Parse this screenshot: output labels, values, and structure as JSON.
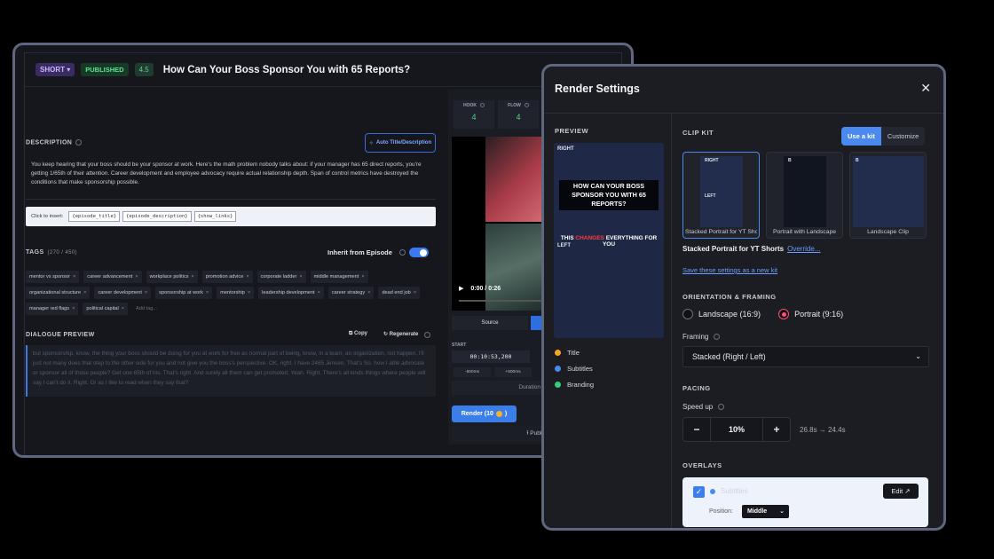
{
  "episode": {
    "badge_short": "SHORT ▾",
    "badge_status": "PUBLISHED",
    "score": "4.5",
    "title": "How Can Your Boss Sponsor You with 65 Reports?"
  },
  "description": {
    "label": "DESCRIPTION",
    "auto_button": "Auto Title/Description",
    "text": "You keep hearing that your boss should be your sponsor at work. Here's the math problem nobody talks about: if your manager has 65 direct reports, you're getting 1/65th of their attention. Career development and employee advocacy require actual relationship depth. Span of control metrics have destroyed the conditions that make sponsorship possible.",
    "insert_label": "Click to insert:",
    "tokens": [
      "{episode_title}",
      "{episode_description}",
      "{show_links}"
    ]
  },
  "tags": {
    "label": "TAGS",
    "count": "(270 / 450)",
    "inherit_label": "Inherit from Episode",
    "items": [
      "mentor vs sponsor",
      "career advancement",
      "workplace politics",
      "promotion advice",
      "corporate ladder",
      "middle management",
      "organizational structure",
      "career development",
      "sponsorship at work",
      "mentorship",
      "leadership development",
      "career strategy",
      "dead end job",
      "manager red flags",
      "political capital"
    ],
    "add_placeholder": "Add tag..."
  },
  "dialogue": {
    "label": "DIALOGUE PREVIEW",
    "copy": "Copy",
    "regenerate": "Regenerate",
    "text": "but sponsorship, know, the thing your boss should be doing for you at work for free as normal part of being, know, in a team, an organization, not happen. I'll just not many does that step to the other side for you and not give you the boss's perspective. OK, right. I have 2465 Jensen. That's So. how I able advocate or sponsor all of those people? Get one 65th of his. That's right. And surely all them can get promoted. Yeah. Right. There's all kinds things where people will say I can't do it. Right. Or as I like to read when they say that?"
  },
  "right_panel": {
    "hook_label": "HOOK",
    "hook_value": "4",
    "flow_label": "FLOW",
    "flow_value": "4",
    "video_time": "0:00 / 0:26",
    "source_tab": "Source",
    "start_label": "START",
    "start_time": "00:10:53,200",
    "nudge_minus": "-500ms",
    "nudge_plus": "+500ms",
    "duration_label": "Duration",
    "render_button": "Render (10",
    "publish_button": "Publis"
  },
  "modal": {
    "title": "Render Settings",
    "preview_label": "PREVIEW",
    "preview_right_tag": "RIGHT",
    "preview_left_tag": "LEFT",
    "preview_caption": "HOW CAN YOUR BOSS SPONSOR YOU WITH 65 REPORTS?",
    "preview_sub_a": "THIS ",
    "preview_sub_b": "CHANGES",
    "preview_sub_c": " EVERYTHING FOR YOU",
    "legend": [
      {
        "label": "Title",
        "color": "#f5a524"
      },
      {
        "label": "Subtitles",
        "color": "#4a8af0"
      },
      {
        "label": "Branding",
        "color": "#2fcf7b"
      }
    ],
    "clip_kit_label": "CLIP KIT",
    "use_kit": "Use a kit",
    "customize": "Customize",
    "kits": [
      {
        "name": "Stacked Portrait for YT Shorts",
        "tag1": "RIGHT",
        "tag2": "LEFT"
      },
      {
        "name": "Portrait with Landscape",
        "tag1": "B",
        "tag2": ""
      },
      {
        "name": "Landscape Clip",
        "tag1": "B",
        "tag2": ""
      }
    ],
    "kit_summary": "Stacked Portrait for YT Shorts",
    "override": "Override...",
    "save_kit": "Save these settings as a new kit",
    "orientation_label": "ORIENTATION & FRAMING",
    "landscape": "Landscape (16:9)",
    "portrait": "Portrait (9:16)",
    "framing_label": "Framing",
    "framing_value": "Stacked (Right / Left)",
    "pacing_label": "PACING",
    "speed_label": "Speed up",
    "speed_minus": "−",
    "speed_value": "10%",
    "speed_plus": "+",
    "speed_result": "26.8s → 24.4s",
    "overlays_label": "OVERLAYS",
    "overlay_name": "Subtitles",
    "edit": "Edit ↗",
    "position_label": "Position:",
    "position_value": "Middle"
  }
}
